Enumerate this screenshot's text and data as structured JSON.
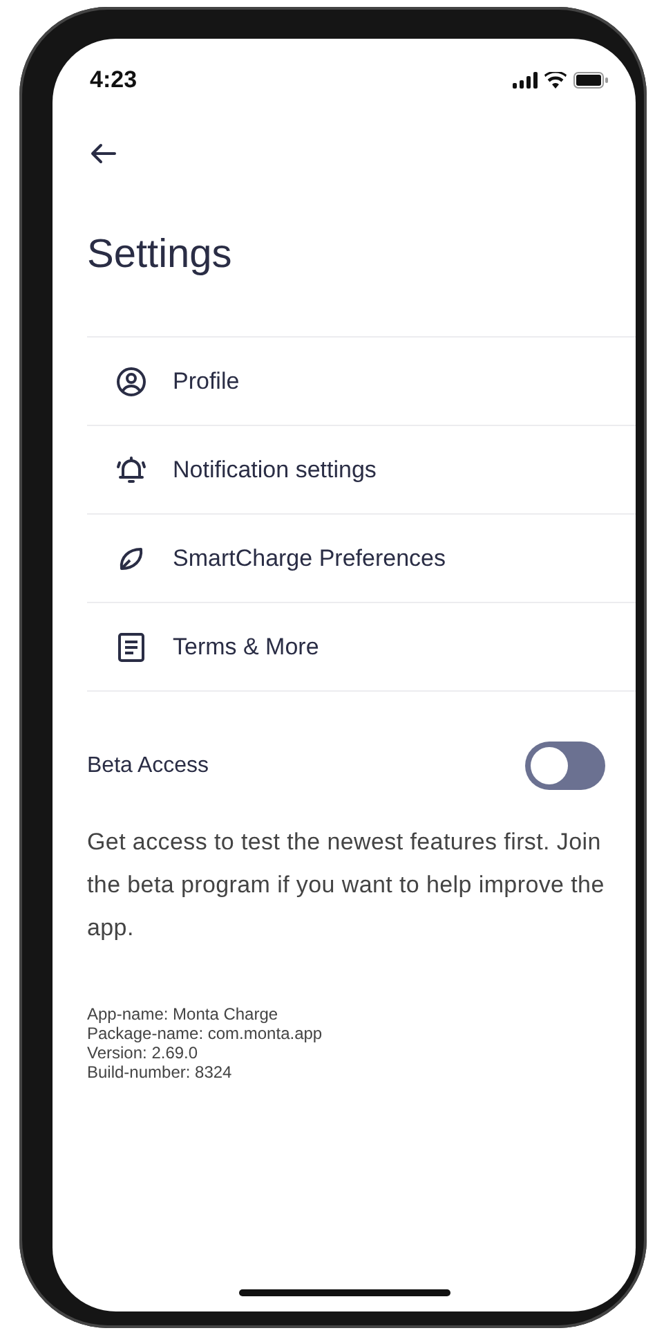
{
  "status_bar": {
    "time": "4:23"
  },
  "title": "Settings",
  "items": [
    {
      "kind": "profile",
      "label": "Profile"
    },
    {
      "kind": "bell",
      "label": "Notification settings"
    },
    {
      "kind": "leaf",
      "label": "SmartCharge Preferences"
    },
    {
      "kind": "document",
      "label": "Terms & More"
    }
  ],
  "beta": {
    "label": "Beta Access",
    "on": false,
    "description": "Get access to test the newest features first. Join the beta program if you want to help improve the app."
  },
  "app_info": [
    "App-name: Monta Charge",
    "Package-name: com.monta.app",
    "Version: 2.69.0",
    "Build-number: 8324"
  ]
}
